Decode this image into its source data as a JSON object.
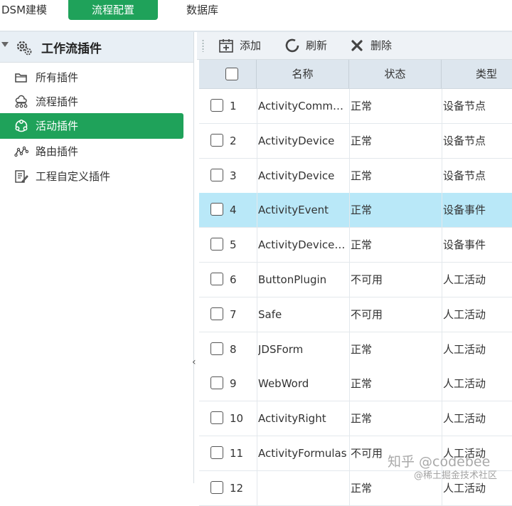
{
  "nav": {
    "tabs": [
      {
        "label": "DSM建模"
      },
      {
        "label": "流程配置"
      },
      {
        "label": "数据库"
      }
    ]
  },
  "sidebar": {
    "title": "工作流插件",
    "items": [
      {
        "label": "所有插件",
        "icon": "folder-icon"
      },
      {
        "label": "流程插件",
        "icon": "cloud-flow-icon"
      },
      {
        "label": "活动插件",
        "icon": "recycle-icon",
        "active": true
      },
      {
        "label": "路由插件",
        "icon": "route-icon"
      },
      {
        "label": "工程自定义插件",
        "icon": "edit-doc-icon"
      }
    ],
    "collapse_glyph": "‹"
  },
  "toolbar": {
    "add_label": "添加",
    "refresh_label": "刷新",
    "delete_label": "删除"
  },
  "table": {
    "columns": [
      "名称",
      "状态",
      "类型"
    ],
    "rows": [
      {
        "no": "1",
        "name": "ActivityCommand",
        "status": "正常",
        "type": "设备节点"
      },
      {
        "no": "2",
        "name": "ActivityDevice",
        "status": "正常",
        "type": "设备节点"
      },
      {
        "no": "3",
        "name": "ActivityDevice",
        "status": "正常",
        "type": "设备节点"
      },
      {
        "no": "4",
        "name": "ActivityEvent",
        "status": "正常",
        "type": "设备事件",
        "selected": true
      },
      {
        "no": "5",
        "name": "ActivityDeviceEv...",
        "status": "正常",
        "type": "设备事件"
      },
      {
        "no": "6",
        "name": "ButtonPlugin",
        "status": "不可用",
        "type": "人工活动"
      },
      {
        "no": "7",
        "name": "Safe",
        "status": "不可用",
        "type": "人工活动"
      },
      {
        "no": "8",
        "name": "JDSForm",
        "status": "正常",
        "type": "人工活动"
      },
      {
        "no": "9",
        "name": "WebWord",
        "status": "正常",
        "type": "人工活动"
      },
      {
        "no": "10",
        "name": "ActivityRight",
        "status": "正常",
        "type": "人工活动"
      },
      {
        "no": "11",
        "name": "ActivityFormulas",
        "status": "不可用",
        "type": "人工活动"
      },
      {
        "no": "12",
        "name": "",
        "status": "正常",
        "type": "人工活动"
      }
    ]
  },
  "watermark": {
    "line1": "知乎 @codebee",
    "line2": "@稀土掘金技术社区"
  },
  "colors": {
    "accent": "#1fa25a",
    "selected_row": "#b9e8f8",
    "header_bg": "#dde6ee"
  }
}
